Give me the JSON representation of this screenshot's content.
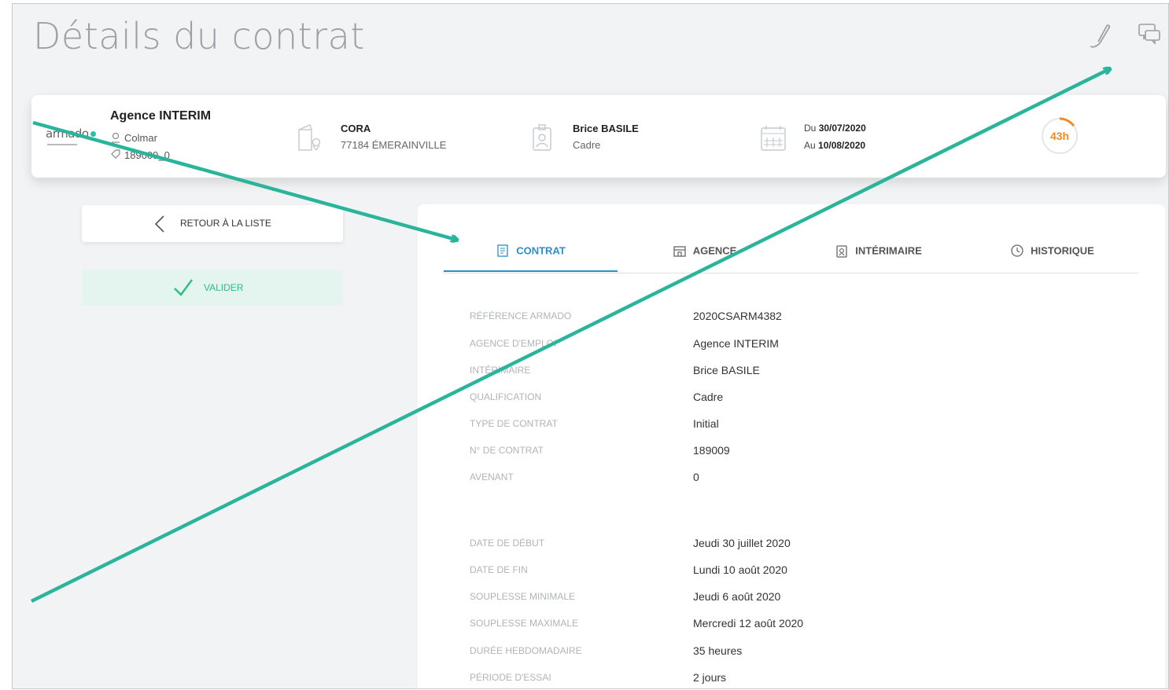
{
  "page": {
    "title": "Détails du contrat"
  },
  "contract_card": {
    "agency_name": "Agence INTERIM",
    "agency_city": "Colmar",
    "agency_code": "189009_0",
    "logo_text": "armado",
    "client_name": "CORA",
    "client_address": "77184 ÉMERAINVILLE",
    "worker_name": "Brice BASILE",
    "worker_qualification": "Cadre",
    "date_from_prefix": "Du",
    "date_from": "30/07/2020",
    "date_to_prefix": "Au",
    "date_to": "10/08/2020",
    "hours_label": "43h",
    "hours_progress": 0.15,
    "accent_color": "#f28b1c"
  },
  "sidebar": {
    "back_label": "RETOUR À LA LISTE",
    "validate_label": "VALIDER",
    "validate_color": "#2cbf84"
  },
  "tabs": [
    {
      "label": "CONTRAT",
      "icon": "contract-icon",
      "active": true
    },
    {
      "label": "AGENCE",
      "icon": "store-icon",
      "active": false
    },
    {
      "label": "INTÉRIMAIRE",
      "icon": "badge-icon",
      "active": false
    },
    {
      "label": "HISTORIQUE",
      "icon": "clock-icon",
      "active": false
    }
  ],
  "details": [
    {
      "label": "RÉFÉRENCE ARMADO",
      "value": "2020CSARM4382"
    },
    {
      "label": "AGENCE D'EMPLOI",
      "value": "Agence INTERIM"
    },
    {
      "label": "INTÉRIMAIRE",
      "value": "Brice BASILE"
    },
    {
      "label": "QUALIFICATION",
      "value": "Cadre"
    },
    {
      "label": "TYPE DE CONTRAT",
      "value": "Initial"
    },
    {
      "label": "N° DE CONTRAT",
      "value": "189009"
    },
    {
      "label": "AVENANT",
      "value": "0"
    },
    {
      "label": "DATE DE DÉBUT",
      "value": "Jeudi 30 juillet 2020"
    },
    {
      "label": "DATE DE FIN",
      "value": "Lundi 10 août 2020"
    },
    {
      "label": "SOUPLESSE MINIMALE",
      "value": "Jeudi 6 août 2020"
    },
    {
      "label": "SOUPLESSE MAXIMALE",
      "value": "Mercredi 12 août 2020"
    },
    {
      "label": "DURÉE HEBDOMADAIRE",
      "value": "35 heures"
    },
    {
      "label": "PÉRIODE D'ESSAI",
      "value": "2 jours"
    }
  ],
  "annotation_color": "#2ab59b"
}
